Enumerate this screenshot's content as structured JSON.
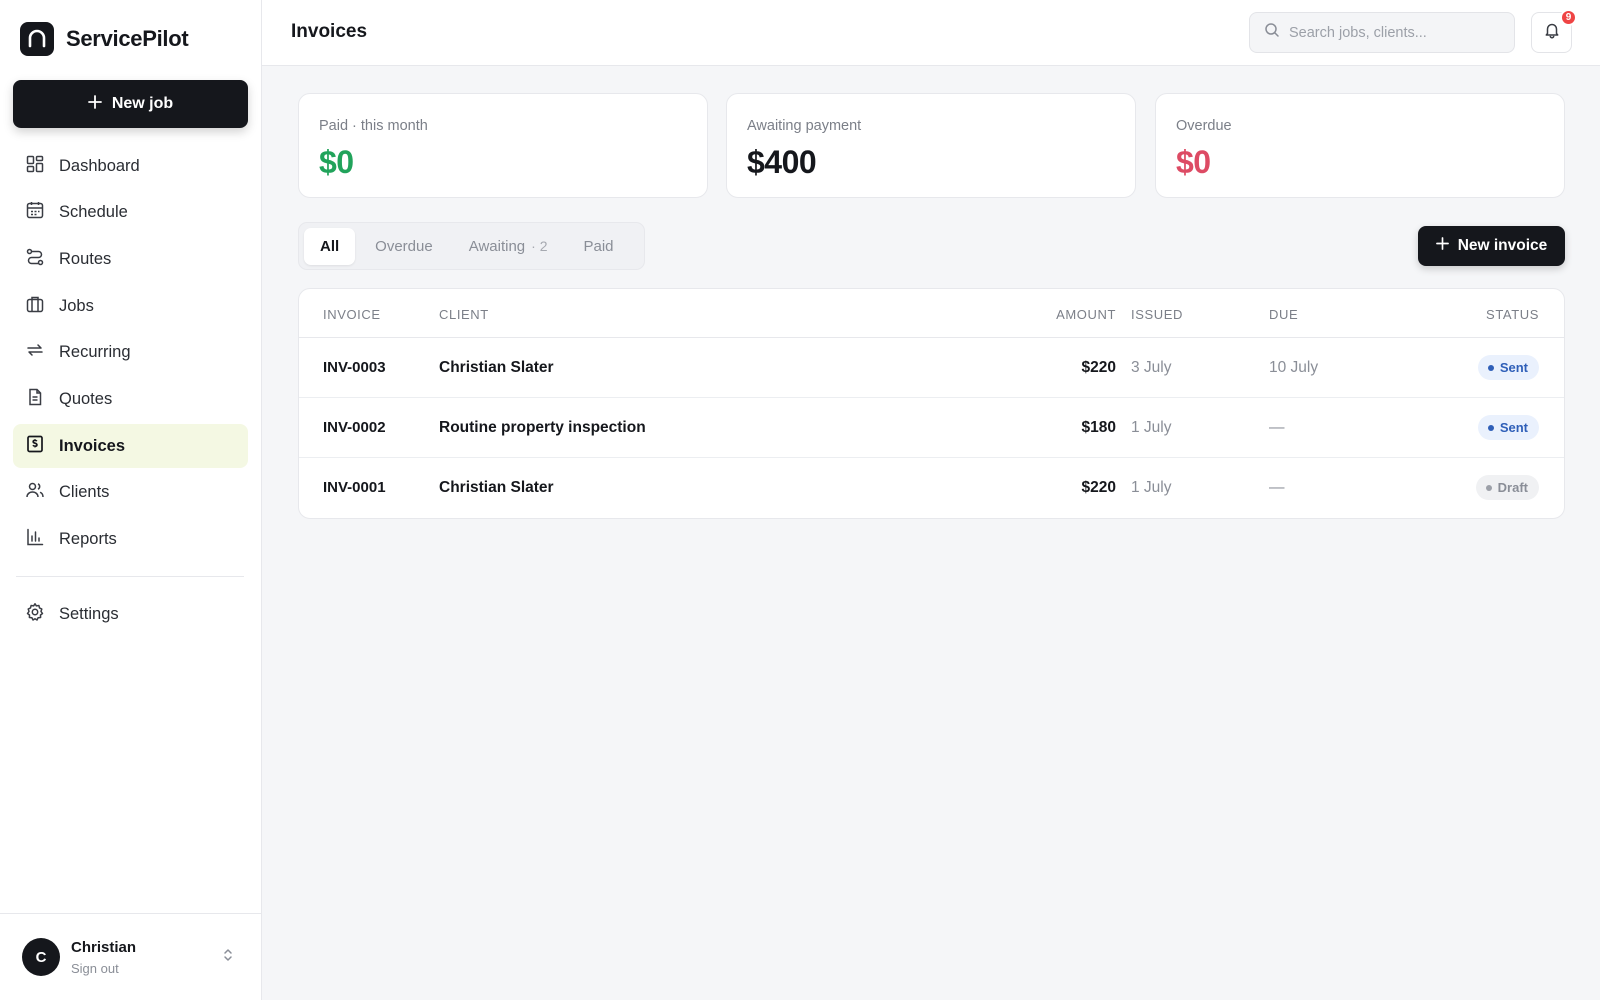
{
  "app": {
    "name": "ServicePilot"
  },
  "sidebar": {
    "new_job_label": "New job",
    "items": [
      {
        "label": "Dashboard",
        "icon": "dashboard-icon",
        "active": false
      },
      {
        "label": "Schedule",
        "icon": "calendar-icon",
        "active": false
      },
      {
        "label": "Routes",
        "icon": "route-icon",
        "active": false
      },
      {
        "label": "Jobs",
        "icon": "briefcase-icon",
        "active": false
      },
      {
        "label": "Recurring",
        "icon": "repeat-icon",
        "active": false
      },
      {
        "label": "Quotes",
        "icon": "document-icon",
        "active": false
      },
      {
        "label": "Invoices",
        "icon": "invoice-icon",
        "active": true
      },
      {
        "label": "Clients",
        "icon": "users-icon",
        "active": false
      },
      {
        "label": "Reports",
        "icon": "bar-chart-icon",
        "active": false
      }
    ],
    "settings_label": "Settings",
    "user": {
      "initial": "C",
      "name": "Christian",
      "sub": "Sign out"
    }
  },
  "header": {
    "title": "Invoices",
    "search_placeholder": "Search jobs, clients...",
    "notification_count": "9"
  },
  "stats": [
    {
      "label": "Paid · this month",
      "value": "$0",
      "color": "#21a35b"
    },
    {
      "label": "Awaiting payment",
      "value": "$400",
      "color": "#15171c"
    },
    {
      "label": "Overdue",
      "value": "$0",
      "color": "#dd4b64"
    }
  ],
  "filters": {
    "tabs": [
      {
        "label": "All",
        "count": "",
        "active": true
      },
      {
        "label": "Overdue",
        "count": "",
        "active": false
      },
      {
        "label": "Awaiting",
        "count": "· 2",
        "active": false
      },
      {
        "label": "Paid",
        "count": "",
        "active": false
      }
    ],
    "new_invoice_label": "New invoice"
  },
  "table": {
    "columns": {
      "invoice": "INVOICE",
      "client": "CLIENT",
      "amount": "AMOUNT",
      "issued": "ISSUED",
      "due": "DUE",
      "status": "STATUS"
    },
    "rows": [
      {
        "invoice": "INV-0003",
        "client": "Christian Slater",
        "amount": "$220",
        "issued": "3 July",
        "due": "10 July",
        "status": "Sent",
        "status_kind": "sent"
      },
      {
        "invoice": "INV-0002",
        "client": "Routine property inspection",
        "amount": "$180",
        "issued": "1 July",
        "due": "—",
        "status": "Sent",
        "status_kind": "sent"
      },
      {
        "invoice": "INV-0001",
        "client": "Christian Slater",
        "amount": "$220",
        "issued": "1 July",
        "due": "—",
        "status": "Draft",
        "status_kind": "draft"
      }
    ]
  }
}
